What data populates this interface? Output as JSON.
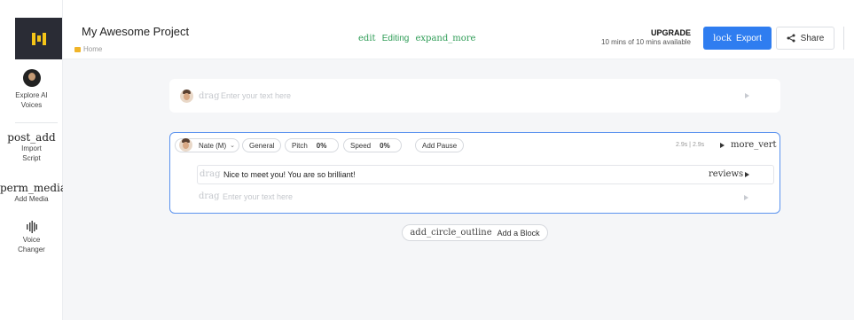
{
  "sidebar": {
    "items": [
      {
        "label": "Explore AI Voices",
        "icon": "ai-voice-avatar-icon"
      },
      {
        "ligature": "post_add",
        "label": "Import Script",
        "icon": "post-add-icon"
      },
      {
        "ligature": "perm_media",
        "label": "Add Media",
        "icon": "perm-media-icon"
      },
      {
        "label": "Voice Changer",
        "icon": "voice-changer-icon"
      }
    ]
  },
  "header": {
    "title": "My Awesome Project",
    "breadcrumb": "Home",
    "status_left_icon": "edit",
    "status_text": "Editing",
    "status_right_icon": "expand_more",
    "upgrade_label": "UPGRADE",
    "usage_text": "10 mins of 10 mins available",
    "export_icon": "lock",
    "export_label": "Export",
    "share_label": "Share"
  },
  "blocks": {
    "block1": {
      "drag_icon": "drag",
      "placeholder": "Enter your text here"
    },
    "block2": {
      "voice_label": "Nate (M)",
      "style_label": "General",
      "pitch_label": "Pitch",
      "pitch_value": "0%",
      "speed_label": "Speed",
      "speed_value": "0%",
      "pause_label": "Add Pause",
      "duration": "2.9s | 2.9s",
      "more_icon": "more_vert",
      "lines": [
        {
          "drag_icon": "drag",
          "text": "Nice to meet you! You are so brilliant!",
          "reviews_icon": "reviews"
        },
        {
          "drag_icon": "drag",
          "placeholder": "Enter your text here"
        }
      ]
    }
  },
  "add_block": {
    "icon": "add_circle_outline",
    "label": "Add a Block"
  },
  "colors": {
    "accent": "#2f7df0",
    "editing_green": "#2e9c56",
    "logo_bg": "#2a2c35",
    "logo_yellow": "#f5c518",
    "active_border": "#5b93ef"
  }
}
